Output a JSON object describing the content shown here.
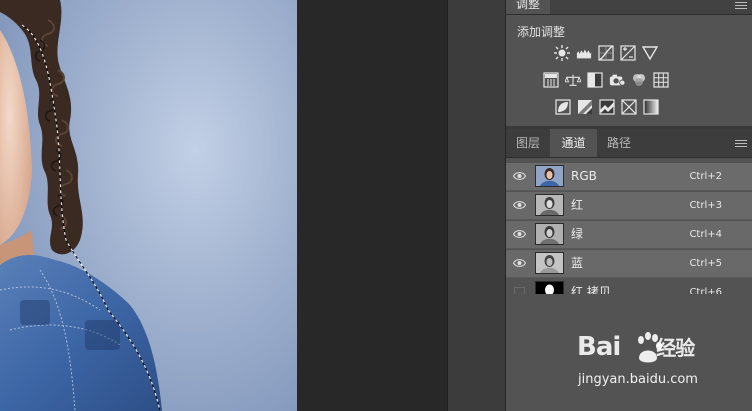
{
  "adjustments": {
    "tab_label": "调整",
    "title": "添加调整",
    "row1_icons": [
      "brightness-contrast-icon",
      "levels-icon",
      "curves-icon",
      "exposure-icon",
      "vibrance-icon"
    ],
    "row2_icons": [
      "hue-saturation-icon",
      "color-balance-icon",
      "black-white-icon",
      "photo-filter-icon",
      "channel-mixer-icon",
      "color-lookup-icon"
    ],
    "row3_icons": [
      "invert-icon",
      "posterize-icon",
      "threshold-icon",
      "selective-color-icon",
      "gradient-map-icon"
    ]
  },
  "channels_panel": {
    "tabs": [
      {
        "label": "图层",
        "active": false
      },
      {
        "label": "通道",
        "active": true
      },
      {
        "label": "路径",
        "active": false
      }
    ],
    "channels": [
      {
        "name": "RGB",
        "shortcut": "Ctrl+2",
        "visible": true,
        "thumb": "color"
      },
      {
        "name": "红",
        "shortcut": "Ctrl+3",
        "visible": true,
        "thumb": "gray"
      },
      {
        "name": "绿",
        "shortcut": "Ctrl+4",
        "visible": true,
        "thumb": "gray"
      },
      {
        "name": "蓝",
        "shortcut": "Ctrl+5",
        "visible": true,
        "thumb": "gray"
      },
      {
        "name": "红 拷贝",
        "shortcut": "Ctrl+6",
        "visible": false,
        "thumb": "mask"
      }
    ]
  },
  "watermark": {
    "logo_text": "Bai",
    "logo_suffix": "经验",
    "url": "jingyan.baidu.com"
  },
  "colors": {
    "panel_bg": "#535353",
    "canvas_bg": "#282828",
    "selected_row": "#696969"
  }
}
